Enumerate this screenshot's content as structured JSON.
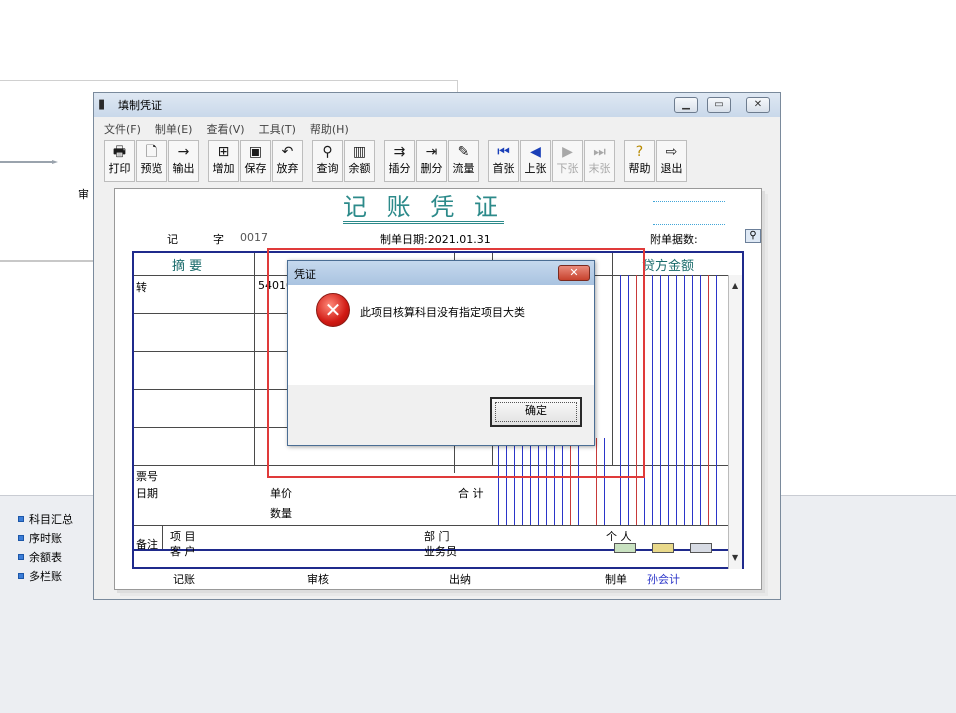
{
  "background": {
    "back_tab_label": "审",
    "side_links": [
      "科目汇总",
      "序时账",
      "余额表",
      "多栏账"
    ]
  },
  "window": {
    "title": "填制凭证",
    "menu": [
      "文件(F)",
      "制单(E)",
      "查看(V)",
      "工具(T)",
      "帮助(H)"
    ],
    "toolbar": [
      {
        "label": "打印",
        "icon": "printer-icon",
        "enabled": true
      },
      {
        "label": "预览",
        "icon": "preview-icon",
        "enabled": true
      },
      {
        "label": "输出",
        "icon": "export-icon",
        "enabled": true
      },
      {
        "label": "增加",
        "icon": "add-icon",
        "enabled": true
      },
      {
        "label": "保存",
        "icon": "save-icon",
        "enabled": true
      },
      {
        "label": "放弃",
        "icon": "undo-icon",
        "enabled": true
      },
      {
        "label": "查询",
        "icon": "binoculars-icon",
        "enabled": true
      },
      {
        "label": "余额",
        "icon": "bar-chart-icon",
        "enabled": true
      },
      {
        "label": "插分",
        "icon": "insert-row-icon",
        "enabled": true
      },
      {
        "label": "删分",
        "icon": "delete-row-icon",
        "enabled": true
      },
      {
        "label": "流量",
        "icon": "flow-icon",
        "enabled": true
      },
      {
        "label": "首张",
        "icon": "first-icon",
        "enabled": true
      },
      {
        "label": "上张",
        "icon": "prev-icon",
        "enabled": true
      },
      {
        "label": "下张",
        "icon": "next-icon",
        "enabled": false
      },
      {
        "label": "末张",
        "icon": "last-icon",
        "enabled": false
      },
      {
        "label": "帮助",
        "icon": "help-icon",
        "enabled": true
      },
      {
        "label": "退出",
        "icon": "exit-icon",
        "enabled": true
      }
    ]
  },
  "voucher": {
    "title": "记 账 凭 证",
    "type_label": "记",
    "zi_label": "字",
    "number": "0017",
    "date_label": "制单日期:2021.01.31",
    "attachments_label": "附单据数:",
    "col_summary": "摘 要",
    "col_credit": "贷方金额",
    "row1_summary": "转",
    "row1_subject": "54010",
    "ticket_no_label": "票号",
    "date_field_label": "日期",
    "unit_price_label": "单价",
    "quantity_label": "数量",
    "total_label": "合 计",
    "remark_label": "备注",
    "project_label": "项 目",
    "customer_label": "客 户",
    "department_label": "部 门",
    "salesperson_label": "业务员",
    "person_label": "个 人",
    "footer": {
      "bookkeeping": "记账",
      "audit": "审核",
      "cashier": "出纳",
      "preparer_label": "制单",
      "preparer_name": "孙会计"
    }
  },
  "dialog": {
    "title": "凭证",
    "message": "此项目核算科目没有指定项目大类",
    "ok_label": "确定",
    "close_glyph": "✕"
  },
  "colors": {
    "voucher_title": "#2c8a8a",
    "grid_border": "#1f2a8c",
    "highlight": "#e03a3a",
    "preparer_name": "#2b35c9"
  }
}
